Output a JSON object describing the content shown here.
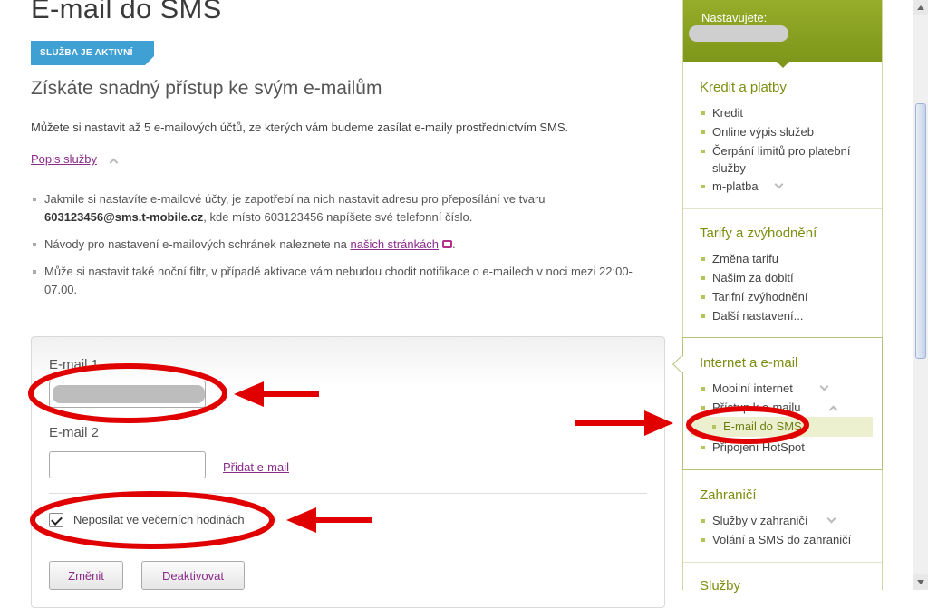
{
  "main": {
    "title": "E-mail do SMS",
    "status_badge": "SLUŽBA JE AKTIVNÍ",
    "subtitle": "Získáte snadný přístup ke svým e-mailům",
    "intro": "Můžete si nastavit až 5 e-mailových účtů, ze kterých vám budeme zasílat e-maily prostřednictvím SMS.",
    "description_toggle": "Popis služby",
    "bullets": {
      "b1_pre": "Jakmile si nastavíte e-mailové účty, je zapotřebí na nich nastavit adresu pro přeposílání ve tvaru",
      "b1_bold": "603123456@sms.t-mobile.cz",
      "b1_post": ", kde místo 603123456 napíšete své telefonní číslo.",
      "b2_pre": "Návody pro nastavení e-mailových schránek naleznete na",
      "b2_link": "našich stránkách",
      "b2_post": ".",
      "b3": "Může si nastavit také noční filtr, v případě aktivace vám nebudou chodit notifikace o e-mailech v noci mezi 22:00-07.00."
    }
  },
  "form": {
    "email1_label": "E-mail 1",
    "email1_value": "",
    "email2_label": "E-mail 2",
    "email2_value": "",
    "add_email": "Přidat e-mail",
    "night_filter_label": "Neposílat ve večerních hodinách",
    "night_filter_checked": true,
    "change_button": "Změnit",
    "deactivate_button": "Deaktivovat"
  },
  "sidebar": {
    "header_label": "Nastavujete:",
    "sections": [
      {
        "title": "Kredit a platby",
        "items": [
          "Kredit",
          "Online výpis služeb",
          "Čerpání limitů pro platební služby",
          "m-platba"
        ]
      },
      {
        "title": "Tarify a zvýhodnění",
        "items": [
          "Změna tarifu",
          "Našim za dobití",
          "Tarifní zvýhodnění",
          "Další nastavení..."
        ]
      },
      {
        "title": "Internet a e-mail",
        "items": [
          "Mobilní internet",
          "Přístup k e-mailu",
          "E-mail do SMS",
          "Připojení HotSpot"
        ],
        "active_item": "E-mail do SMS"
      },
      {
        "title": "Zahraničí",
        "items": [
          "Služby v zahraničí",
          "Volání a SMS do zahraničí"
        ]
      },
      {
        "title": "Služby",
        "items": []
      }
    ]
  },
  "colors": {
    "accent_green": "#7e961a",
    "link_purple": "#8a2b8a",
    "badge_blue": "#3fa0d4",
    "annotation_red": "#e00000"
  }
}
